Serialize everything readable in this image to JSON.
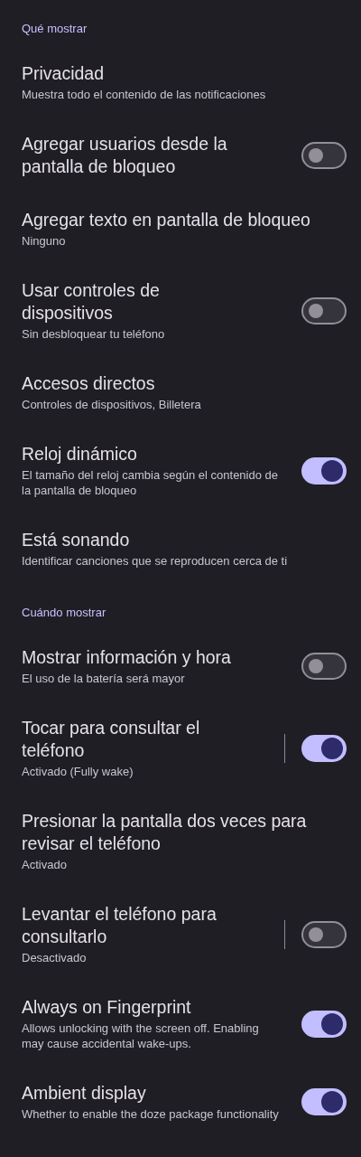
{
  "sections": [
    {
      "header": "Qué mostrar",
      "items": [
        {
          "kind": "plain",
          "title": "Privacidad",
          "summary": "Muestra todo el contenido de las notificaciones"
        },
        {
          "kind": "switch",
          "title": "Agregar usuarios desde la pantalla de bloqueo",
          "on": false,
          "divider": false
        },
        {
          "kind": "plain",
          "title": "Agregar texto en pantalla de bloqueo",
          "summary": "Ninguno"
        },
        {
          "kind": "switch",
          "title": "Usar controles de dispositivos",
          "summary": "Sin desbloquear tu teléfono",
          "on": false,
          "divider": false
        },
        {
          "kind": "plain",
          "title": "Accesos directos",
          "summary": "Controles de dispositivos, Billetera"
        },
        {
          "kind": "switch",
          "title": "Reloj dinámico",
          "summary": "El tamaño del reloj cambia según el contenido de la pantalla de bloqueo",
          "on": true,
          "divider": false
        },
        {
          "kind": "plain",
          "title": "Está sonando",
          "summary": "Identificar canciones que se reproducen cerca de ti"
        }
      ]
    },
    {
      "header": "Cuándo mostrar",
      "items": [
        {
          "kind": "switch",
          "title": "Mostrar información y hora",
          "summary": "El uso de la batería será mayor",
          "on": false,
          "divider": false
        },
        {
          "kind": "switch",
          "title": "Tocar para consultar el teléfono",
          "summary": "Activado (Fully wake)",
          "on": true,
          "divider": true
        },
        {
          "kind": "plain",
          "title": "Presionar la pantalla dos veces para revisar el teléfono",
          "summary": "Activado"
        },
        {
          "kind": "switch",
          "title": "Levantar el teléfono para consultarlo",
          "summary": "Desactivado",
          "on": false,
          "divider": true
        },
        {
          "kind": "switch",
          "title": "Always on Fingerprint",
          "summary": "Allows unlocking with the screen off. Enabling may cause accidental wake-ups.",
          "on": true,
          "divider": false
        },
        {
          "kind": "switch",
          "title": "Ambient display",
          "summary": "Whether to enable the doze package functionality",
          "on": true,
          "divider": false
        }
      ]
    }
  ]
}
